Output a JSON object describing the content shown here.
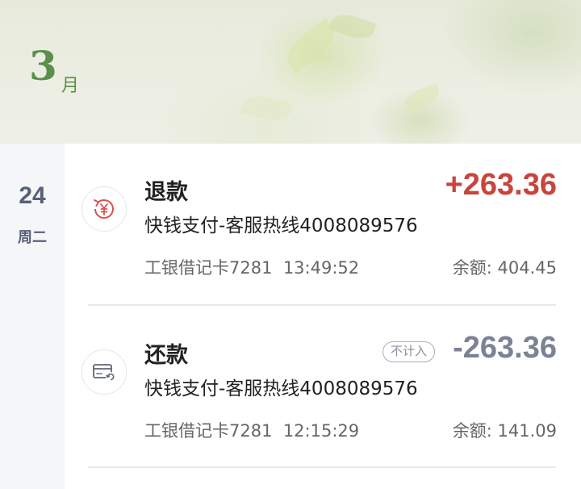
{
  "header": {
    "month_number": "3",
    "month_unit": "月"
  },
  "date": {
    "day": "24",
    "weekday": "周二"
  },
  "transactions": [
    {
      "title": "退款",
      "description": "快钱支付-客服热线4008089576",
      "amount": "+263.36",
      "amount_color": "#c8443c",
      "card": "工银借记卡7281",
      "time": "13:49:52",
      "balance": "余额: 404.45",
      "icon": "refund-yuan-icon",
      "tag": ""
    },
    {
      "title": "还款",
      "description": "快钱支付-客服热线4008089576",
      "amount": "-263.36",
      "amount_color": "#7b8296",
      "card": "工银借记卡7281",
      "time": "12:15:29",
      "balance": "余额: 141.09",
      "icon": "card-repayment-icon",
      "tag": "不计入"
    }
  ],
  "colors": {
    "accent_green": "#5b8f4b",
    "income_red": "#c8443c",
    "expense_gray": "#7b8296"
  }
}
